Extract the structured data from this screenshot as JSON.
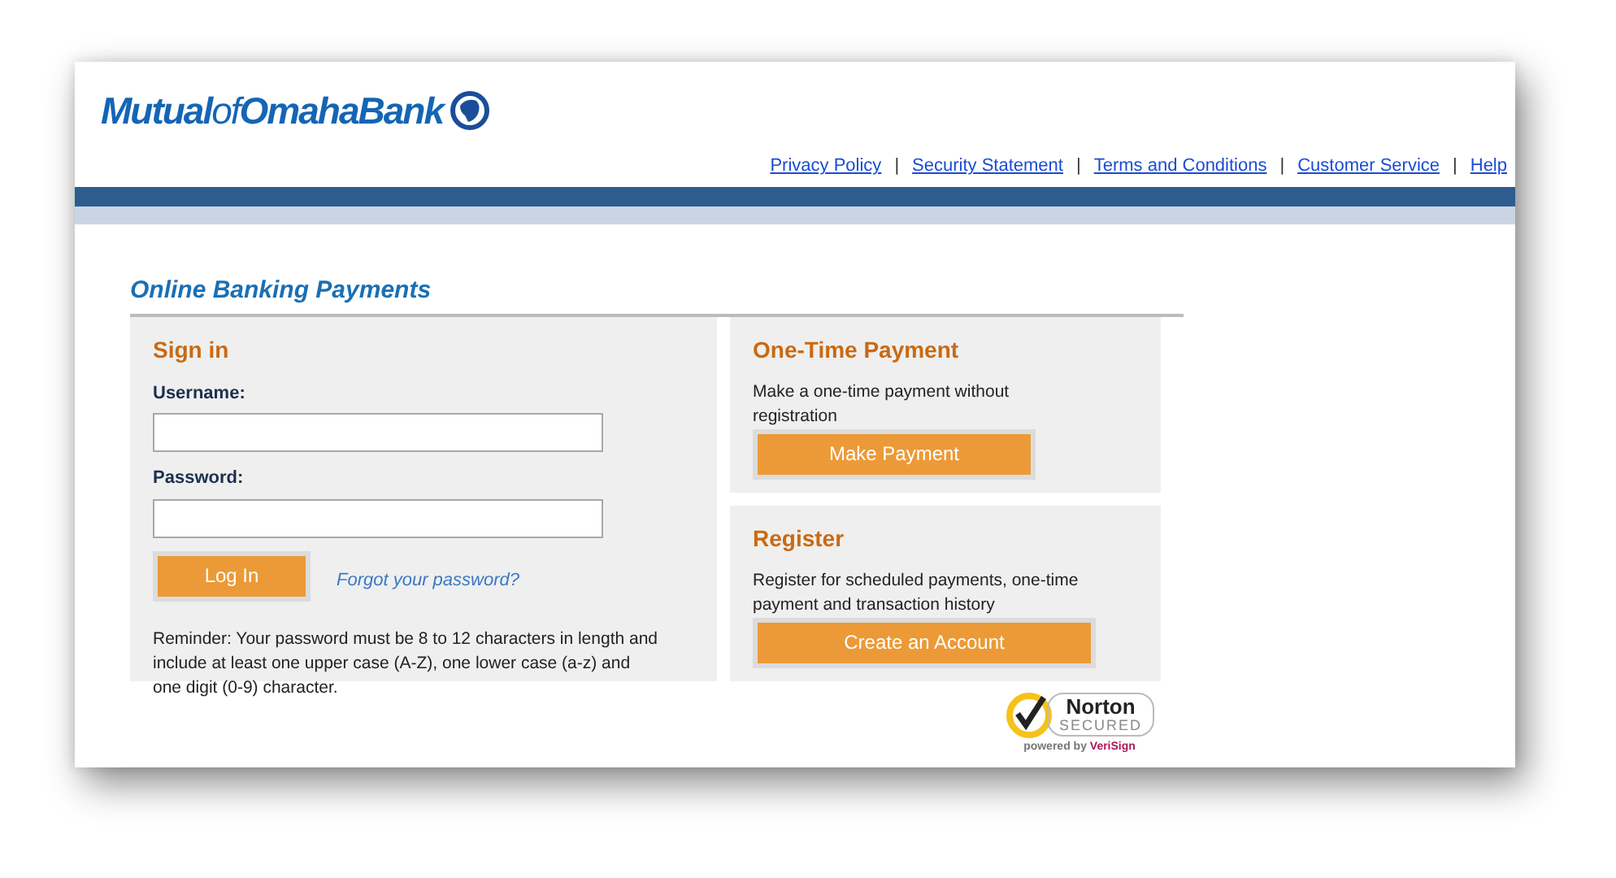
{
  "logo": {
    "text": "**Mutual**of**OmahaBank**"
  },
  "top_links": [
    "Privacy Policy",
    "Security Statement",
    "Terms and Conditions",
    "Customer Service",
    "Help"
  ],
  "link_separator": "|",
  "page_title": "Online Banking Payments",
  "sign_in": {
    "title": "Sign in",
    "fields": [
      {
        "label": "Username:"
      },
      {
        "label": "Password:"
      }
    ],
    "button": "Log In",
    "forgot_link": "Forgot your password?",
    "reminder": "Reminder: Your password must be 8 to 12 characters in length and include at least one upper case (A-Z), one lower case (a-z) and one digit (0-9) character."
  },
  "panels": [
    {
      "title": "One-Time Payment",
      "text": "Make a one-time payment without registration",
      "button": "Make Payment"
    },
    {
      "title": "Register",
      "text": "Register for scheduled payments, one-time payment and transaction history",
      "button": "Create an Account"
    }
  ],
  "seal": {
    "name": "Norton",
    "status": "SECURED",
    "powered_by": "powered by",
    "provider": "VeriSign"
  }
}
